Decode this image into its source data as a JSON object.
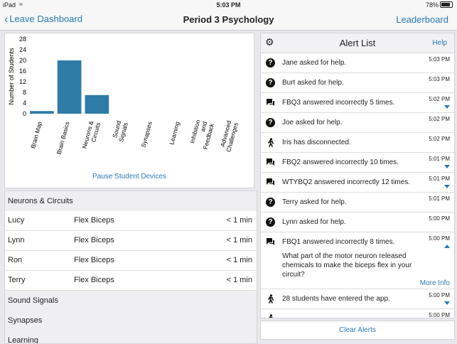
{
  "status": {
    "carrier": "iPad",
    "time": "5:03 PM",
    "battery": "78%"
  },
  "nav": {
    "back_label": "Leave Dashboard",
    "title": "Period 3 Psychology",
    "leaderboard_label": "Leaderboard"
  },
  "chart_data": {
    "type": "bar",
    "ylabel": "Number of Students",
    "ylim": [
      0,
      28
    ],
    "yticks": [
      "0",
      "4",
      "8",
      "12",
      "16",
      "20",
      "24",
      "28"
    ],
    "categories": [
      "Brain Map",
      "Brain Basics",
      "Neurons &\nCircuits",
      "Sound\nSignals",
      "Synapses",
      "Learning",
      "Inhibition\nand\nFeedback",
      "Advanced\nChallenges"
    ],
    "values": [
      1,
      20,
      7,
      0,
      0,
      0,
      0,
      0
    ],
    "bar_color": "#2e7ba8"
  },
  "pause_label": "Pause Student Devices",
  "students": {
    "group_title": "Neurons & Circuits",
    "rows": [
      {
        "name": "Lucy",
        "activity": "Flex Biceps",
        "time": "< 1 min"
      },
      {
        "name": "Lynn",
        "activity": "Flex Biceps",
        "time": "< 1 min"
      },
      {
        "name": "Ron",
        "activity": "Flex Biceps",
        "time": "< 1 min"
      },
      {
        "name": "Terry",
        "activity": "Flex Biceps",
        "time": "< 1 min"
      }
    ],
    "other_groups": [
      "Sound Signals",
      "Synapses",
      "Learning"
    ]
  },
  "alerts": {
    "title": "Alert List",
    "help_label": "Help",
    "items": [
      {
        "icon": "question-icon",
        "text": "Jane asked for help.",
        "time": "5:03 PM"
      },
      {
        "icon": "question-icon",
        "text": "Burt asked for help.",
        "time": "5:03 PM"
      },
      {
        "icon": "chat-icon",
        "text": "FBQ3 answered incorrectly 5 times.",
        "time": "5:02 PM",
        "caret": "down"
      },
      {
        "icon": "question-icon",
        "text": "Joe asked for help.",
        "time": "5:02 PM"
      },
      {
        "icon": "walk-icon",
        "text": "Iris has disconnected.",
        "time": "5:02 PM"
      },
      {
        "icon": "chat-icon",
        "text": "FBQ2 answered incorrectly 10 times.",
        "time": "5:01 PM",
        "caret": "down"
      },
      {
        "icon": "chat-icon",
        "text": "WTYBQ2 answered incorrectly 12 times.",
        "time": "5:01 PM",
        "caret": "down"
      },
      {
        "icon": "question-icon",
        "text": "Terry asked for help.",
        "time": "5:01 PM"
      },
      {
        "icon": "question-icon",
        "text": "Lynn asked for help.",
        "time": "5:00 PM"
      },
      {
        "icon": "chat-icon",
        "text": "FBQ1 answered incorrectly 8 times.",
        "time": "5:00 PM",
        "caret": "up",
        "detail": "What part of the motor neuron released chemicals to make the biceps flex in your circuit?",
        "more_label": "More Info"
      },
      {
        "icon": "walk-icon",
        "text": "28 students have entered the app.",
        "time": "5:00 PM",
        "caret": "down"
      },
      {
        "icon": "walk-icon",
        "text": "",
        "time": "5:00 PM"
      }
    ]
  },
  "clear_label": "Clear Alerts"
}
